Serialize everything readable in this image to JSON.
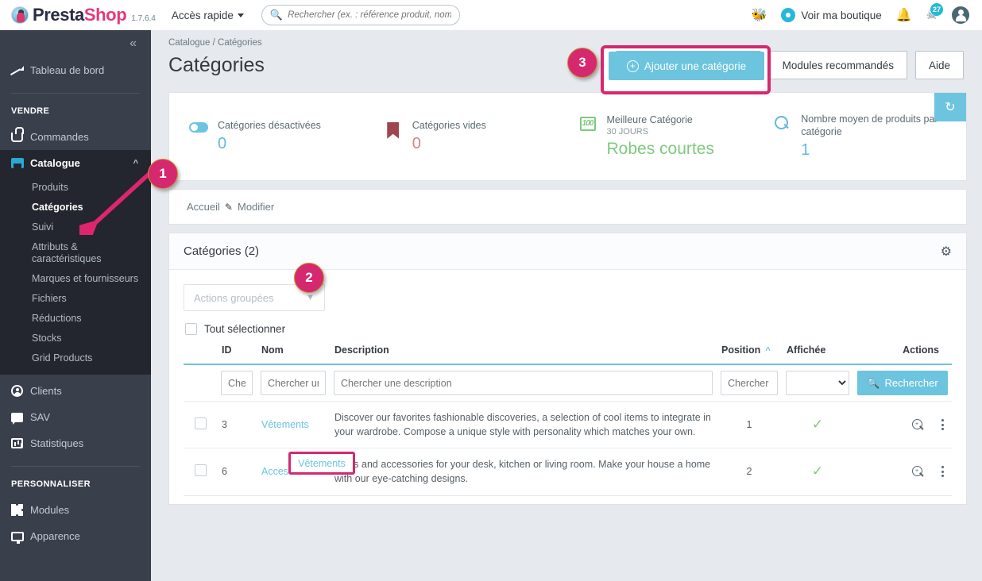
{
  "header": {
    "brand_presta": "Presta",
    "brand_shop": "Shop",
    "version": "1.7.6.4",
    "quick_access": "Accès rapide",
    "search_placeholder": "Rechercher (ex. : référence produit, nom",
    "search_value": "",
    "view_shop": "Voir ma boutique",
    "notif_badge": "27",
    "icons": [
      "bug-icon",
      "eye-icon",
      "bell-icon",
      "support-icon",
      "account-icon"
    ]
  },
  "sidebar": {
    "collapse_label": "«",
    "dashboard": {
      "label": "Tableau de bord",
      "icon": "trend-chart-icon"
    },
    "section_sell": "VENDRE",
    "items": [
      {
        "label": "Commandes",
        "icon": "basket-icon"
      },
      {
        "label": "Catalogue",
        "icon": "store-icon"
      },
      {
        "label": "Clients",
        "icon": "person-icon"
      },
      {
        "label": "SAV",
        "icon": "chat-icon"
      },
      {
        "label": "Statistiques",
        "icon": "bar-chart-icon"
      }
    ],
    "catalogue_sub": [
      "Produits",
      "Catégories",
      "Suivi",
      "Attributs & caractéristiques",
      "Marques et fournisseurs",
      "Fichiers",
      "Réductions",
      "Stocks",
      "Grid Products"
    ],
    "section_customize": "PERSONNALISER",
    "customize_items": [
      {
        "label": "Modules",
        "icon": "puzzle-icon"
      },
      {
        "label": "Apparence",
        "icon": "monitor-icon"
      }
    ]
  },
  "page": {
    "breadcrumb": "Catalogue / Catégories",
    "title": "Catégories",
    "btn_add": "Ajouter une catégorie",
    "btn_modules": "Modules recommandés",
    "btn_help": "Aide"
  },
  "kpis": [
    {
      "label": "Catégories désactivées",
      "value": "0",
      "icon": "toggle-icon",
      "sub": ""
    },
    {
      "label": "Catégories vides",
      "value": "0",
      "icon": "bookmark-icon",
      "sub": ""
    },
    {
      "label": "Meilleure Catégorie",
      "value": "Robes courtes",
      "icon": "hundred-icon",
      "sub": "30 JOURS"
    },
    {
      "label": "Nombre moyen de produits par catégorie",
      "value": "1",
      "icon": "magnifier-icon",
      "sub": ""
    }
  ],
  "refresh_icon": "refresh-icon",
  "tree_breadcrumb": {
    "home": "Accueil",
    "edit": "Modifier"
  },
  "list": {
    "title": "Catégories (2)",
    "gear_icon": "gear-icon",
    "bulk_actions": "Actions groupées",
    "select_all": "Tout sélectionner",
    "columns": [
      "ID",
      "Nom",
      "Description",
      "Position",
      "Affichée",
      "Actions"
    ],
    "sort_column": "Position",
    "sort_direction": "^",
    "filters": {
      "id": "Chercher",
      "name": "Chercher un nom",
      "description": "Chercher une description",
      "position": "Chercher une position",
      "displayed": "",
      "search_button": "Rechercher"
    },
    "rows": [
      {
        "id": "3",
        "name": "Vêtements",
        "description": "Discover our favorites fashionable discoveries, a selection of cool items to integrate in your wardrobe. Compose a unique style with personality which matches your own.",
        "position": "1",
        "displayed": "✓"
      },
      {
        "id": "6",
        "name": "Accessoires",
        "description": "Items and accessories for your desk, kitchen or living room. Make your house a home with our eye-catching designs.",
        "position": "2",
        "displayed": "✓"
      }
    ]
  },
  "annotations": {
    "marker1": "1",
    "marker2": "2",
    "marker3": "3",
    "highlight_color": "#d6286e"
  }
}
